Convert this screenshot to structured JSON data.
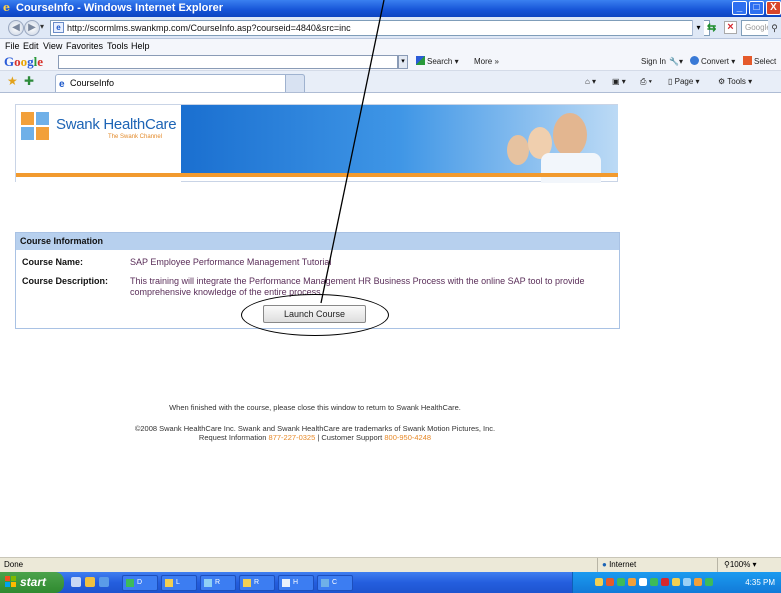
{
  "window": {
    "title": "CourseInfo - Windows Internet Explorer",
    "min_label": "_",
    "max_label": "□",
    "close_label": "X"
  },
  "address": {
    "url": "http://scormlms.swankmp.com/CourseInfo.asp?courseid=4840&src=inc",
    "search_placeholder": "Google"
  },
  "menu": {
    "items": [
      "File",
      "Edit",
      "View",
      "Favorites",
      "Tools",
      "Help"
    ]
  },
  "googlebar": {
    "logo": [
      "G",
      "o",
      "o",
      "g",
      "l",
      "e"
    ],
    "search_label": "Search",
    "more_label": "More »",
    "signin_label": "Sign In",
    "convert_label": "Convert",
    "select_label": "Select"
  },
  "tabs": {
    "active_label": "CourseInfo",
    "page_label": "Page",
    "tools_label": "Tools"
  },
  "page": {
    "logo_title": "Swank HealthCare",
    "logo_tagline": "The Swank Channel",
    "info_header": "Course Information",
    "course_name_label": "Course Name:",
    "course_name": "SAP Employee Performance Management Tutorial",
    "course_desc_label": "Course Description:",
    "course_desc_line1": "This training will integrate the Performance Management HR Business Process with the online SAP tool to provide",
    "course_desc_line2": "comprehensive knowledge of the entire process.",
    "launch_label": "Launch Course",
    "footer_line1": "When finished with the course, please close this window to return to Swank HealthCare.",
    "footer_line2": "©2008 Swank HealthCare Inc. Swank and Swank HealthCare are trademarks of Swank Motion Pictures, Inc.",
    "footer_req": "Request Information",
    "footer_req_phone": "877-227-0325",
    "footer_sep": "| Customer Support",
    "footer_support_phone": "800-950-4248"
  },
  "status": {
    "text": "Done",
    "zone": "Internet",
    "zoom": "100%"
  },
  "taskbar": {
    "start_label": "start",
    "buttons": [
      "D",
      "L",
      "R",
      "R",
      "H",
      "C"
    ],
    "clock": "4:35 PM"
  },
  "colors": {
    "title_blue": "#1553d6",
    "brand_blue": "#1d64b5",
    "brand_orange": "#f29a2e",
    "info_header_bg": "#b7d0ee",
    "value_text": "#5a2e59"
  }
}
